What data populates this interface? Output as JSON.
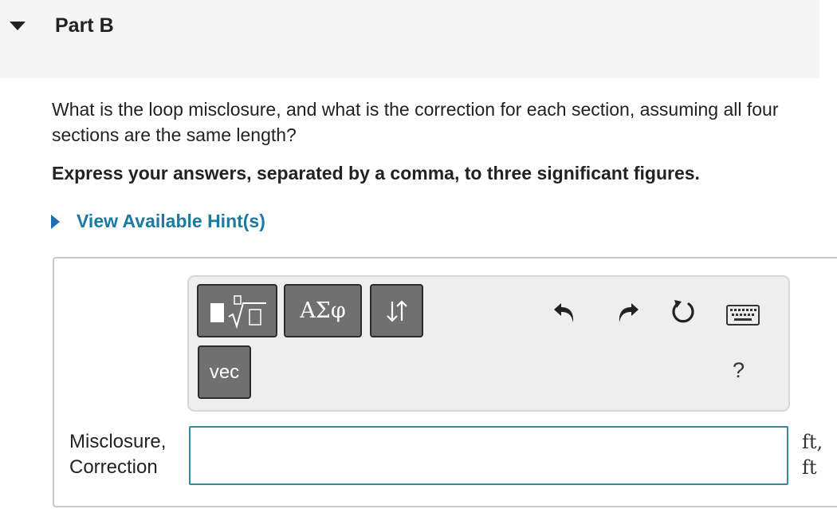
{
  "part": {
    "title": "Part B"
  },
  "question": {
    "text": "What is the loop misclosure, and what is the correction for each section, assuming all four sections are the same length?",
    "instruction": "Express your answers, separated by a comma, to three significant figures."
  },
  "hint": {
    "label": "View Available Hint(s)"
  },
  "toolbar": {
    "greek_label": "ΑΣφ",
    "vec_label": "vec",
    "help_label": "?",
    "icons": [
      "templates-icon",
      "arrows-icon",
      "undo-icon",
      "redo-icon",
      "reset-icon",
      "keyboard-icon"
    ]
  },
  "answer": {
    "label_line1": "Misclosure,",
    "label_line2": "Correction",
    "value": "",
    "unit_line1": "ft,",
    "unit_line2": "ft"
  },
  "colors": {
    "link": "#1a7aa0",
    "input_border": "#2f8a9a",
    "button_bg": "#707070",
    "header_bg": "#f5f5f5"
  }
}
